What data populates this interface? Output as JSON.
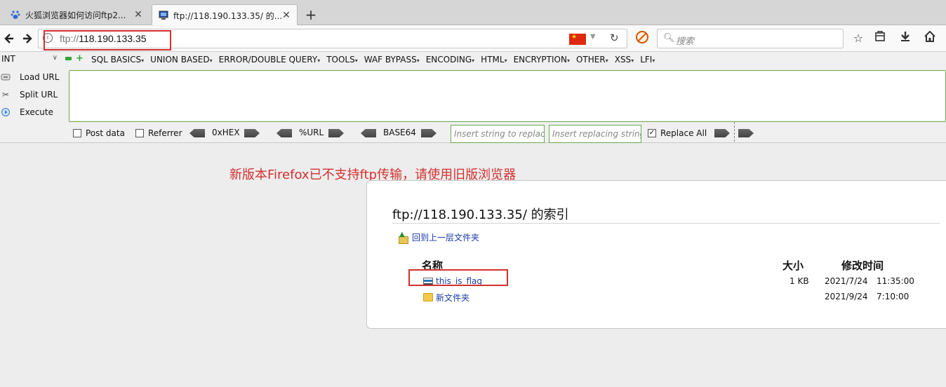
{
  "tabs": [
    {
      "title": "火狐浏览器如何访问ftp2...",
      "close": "✕"
    },
    {
      "title": "ftp://118.190.133.35/ 的...",
      "close": "✕"
    }
  ],
  "newtab": "+",
  "navbar": {
    "url_scheme": "ftp://",
    "url_host": "118.190.133.35",
    "search_placeholder": "搜索"
  },
  "hackbar": {
    "int_select": "INT",
    "menu": [
      "SQL BASICS",
      "UNION BASED",
      "ERROR/DOUBLE QUERY",
      "TOOLS",
      "WAF BYPASS",
      "ENCODING",
      "HTML",
      "ENCRYPTION",
      "OTHER",
      "XSS",
      "LFI"
    ],
    "load_url": "Load URL",
    "split_url": "Split URL",
    "execute": "Execute",
    "post_data": "Post data",
    "referrer": "Referrer",
    "hex": "0xHEX",
    "url_enc": "%URL",
    "base64": "BASE64",
    "replace_placeholder": "Insert string to replace",
    "replacing_placeholder": "Insert replacing string",
    "replace_all": "Replace All"
  },
  "annotation": "新版本Firefox已不支持ftp传输，请使用旧版浏览器",
  "listing": {
    "title": "ftp://118.190.133.35/ 的索引",
    "up_link": "回到上一层文件夹",
    "col_name": "名称",
    "col_size": "大小",
    "col_modified": "修改时间",
    "rows": [
      {
        "name": "this_is_flag",
        "size": "1 KB",
        "date": "2021/7/24",
        "time": "11:35:00"
      },
      {
        "name": "新文件夹",
        "size": "",
        "date": "2021/9/24",
        "time": "7:10:00"
      }
    ]
  }
}
